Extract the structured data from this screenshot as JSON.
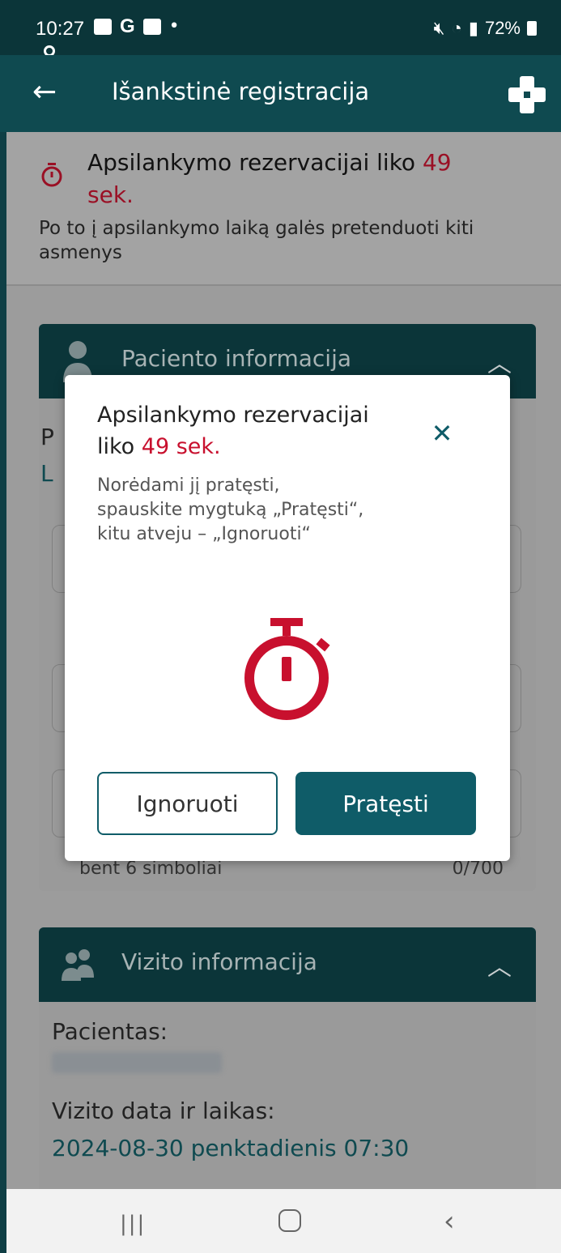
{
  "status_bar": {
    "time": "10:27",
    "battery": "72%"
  },
  "app_bar": {
    "title": "Išankstinė registracija"
  },
  "banner": {
    "title_prefix": "Apsilankymo rezervacijai liko ",
    "seconds": "49",
    "unit": "sek.",
    "subtitle": "Po to į apsilankymo laiką galės pretenduoti kiti asmenys"
  },
  "patient_card": {
    "title": "Paciento informacija",
    "label_p": "P",
    "label_l": "L",
    "footer_left": "bent 6 simboliai",
    "footer_right": "0/700"
  },
  "visit_card": {
    "title": "Vizito informacija",
    "patient_label": "Pacientas:",
    "datetime_label": "Vizito data ir laikas:",
    "datetime_value": "2024-08-30 penktadienis 07:30"
  },
  "modal": {
    "title_prefix": "Apsilankymo rezervacijai liko ",
    "seconds_text": "49 sek.",
    "body": "Norėdami jį pratęsti, spauskite mygtuką „Pratęsti“, kitu atveju – „Ignoruoti“",
    "ignore_label": "Ignoruoti",
    "extend_label": "Pratęsti"
  },
  "colors": {
    "primary": "#0f5c68",
    "header": "#0f4a50",
    "accent_red": "#c8102e"
  },
  "icons": {
    "back": "back-arrow-icon",
    "logo": "medical-cross-icon",
    "timer": "stopwatch-icon",
    "close": "close-icon",
    "collapse": "chevron-up-icon"
  }
}
